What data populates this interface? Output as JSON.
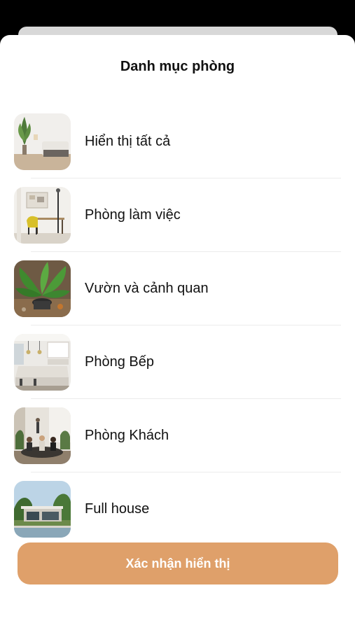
{
  "sheet": {
    "title": "Danh mục phòng"
  },
  "categories": [
    {
      "label": "Hiển thị tất cả",
      "thumbnail": "living-room-plant-image"
    },
    {
      "label": "Phòng làm việc",
      "thumbnail": "home-office-image"
    },
    {
      "label": "Vườn và cảnh quan",
      "thumbnail": "garden-plant-image"
    },
    {
      "label": "Phòng Bếp",
      "thumbnail": "kitchen-image"
    },
    {
      "label": "Phòng Khách",
      "thumbnail": "living-room-people-image"
    },
    {
      "label": "Full house",
      "thumbnail": "house-exterior-image"
    }
  ],
  "footer": {
    "confirm_label": "Xác nhận hiển thị"
  },
  "colors": {
    "accent": "#dfa06a",
    "background": "#ffffff",
    "text": "#111111"
  }
}
